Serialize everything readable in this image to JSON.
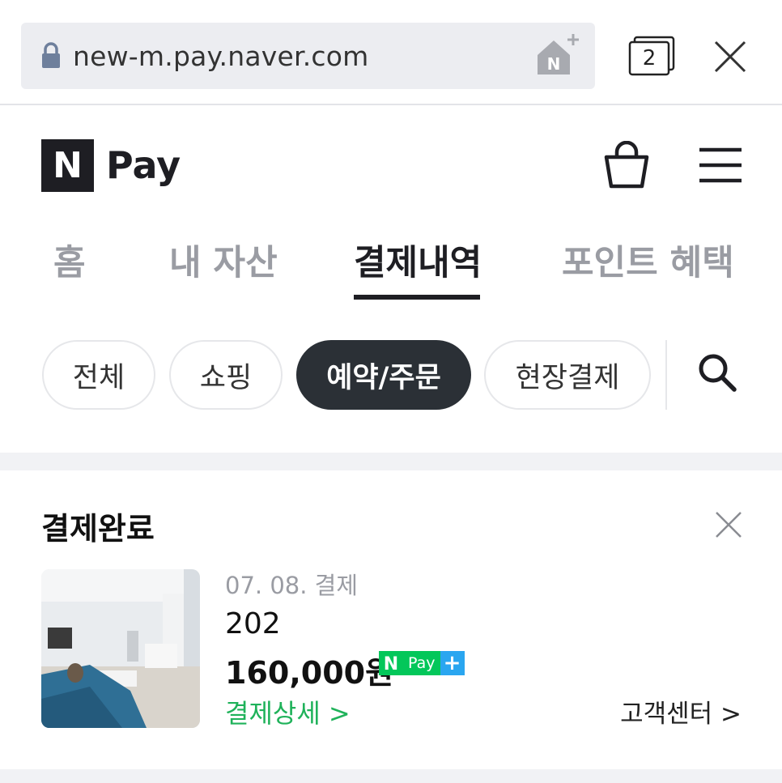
{
  "browser": {
    "url": "new-m.pay.naver.com",
    "tab_count": "2"
  },
  "header": {
    "logo_letter": "N",
    "logo_text": "Pay"
  },
  "nav": {
    "tabs": [
      {
        "label": "홈",
        "active": false
      },
      {
        "label": "내 자산",
        "active": false
      },
      {
        "label": "결제내역",
        "active": true
      },
      {
        "label": "포인트 혜택",
        "active": false
      }
    ]
  },
  "filters": {
    "chips": [
      {
        "label": "전체",
        "active": false
      },
      {
        "label": "쇼핑",
        "active": false
      },
      {
        "label": "예약/주문",
        "active": true
      },
      {
        "label": "현장결제",
        "active": false
      }
    ]
  },
  "order": {
    "status_title": "결제완료",
    "date": "07. 08. 결제",
    "name": "202",
    "price": "160,000원",
    "badge": {
      "n": "N",
      "pay": "Pay",
      "plus": "+"
    },
    "detail_link": "결제상세 >",
    "support_link": "고객센터 >"
  },
  "colors": {
    "brand_dark": "#1e1e23",
    "naver_green": "#03c75a",
    "link_green": "#1fb25a",
    "chip_active_bg": "#2b3036"
  }
}
